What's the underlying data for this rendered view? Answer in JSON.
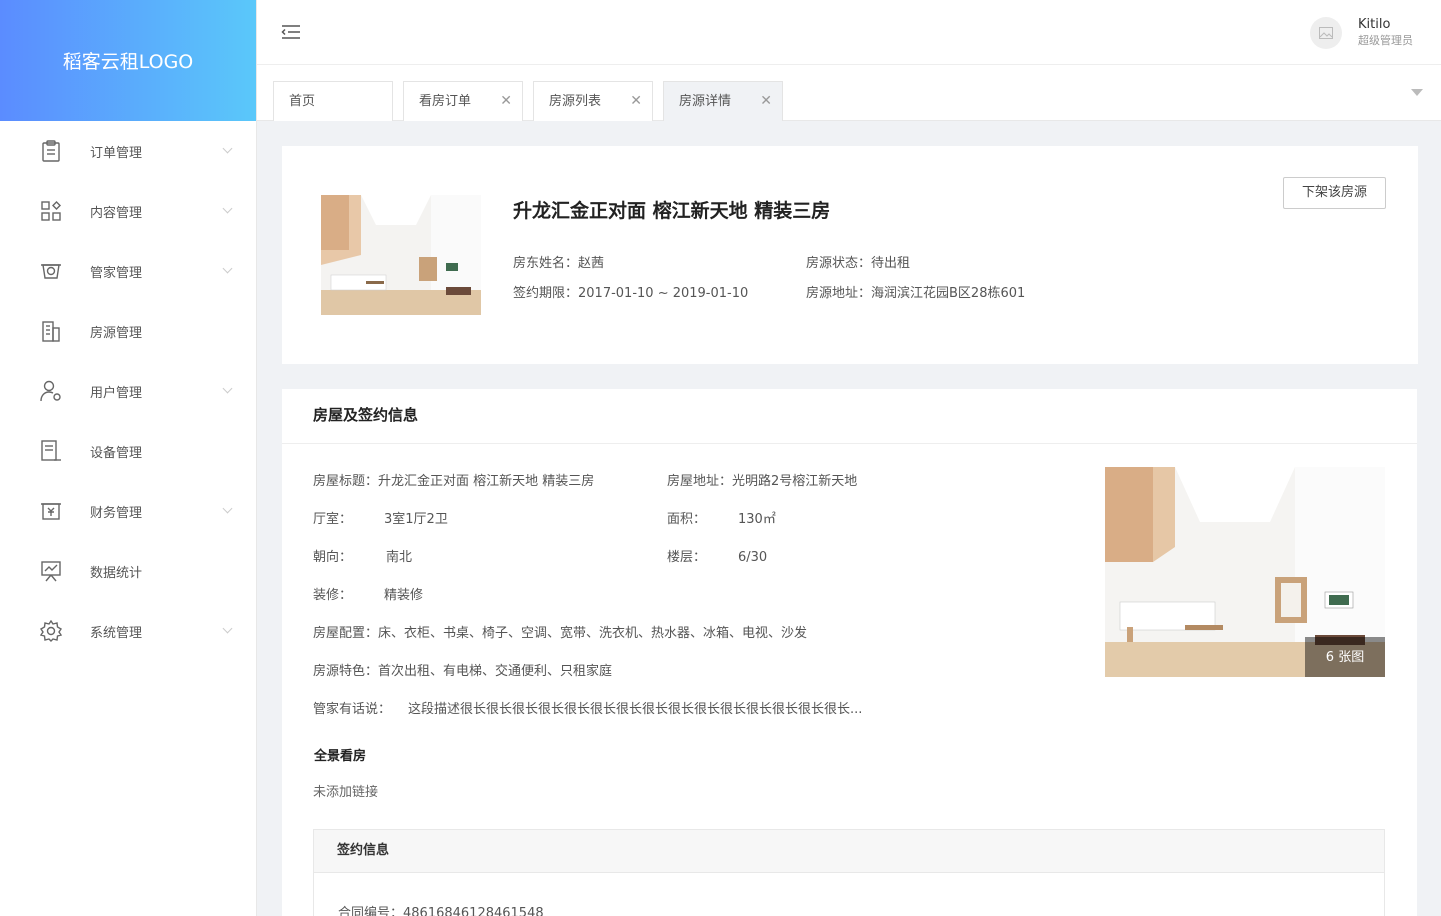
{
  "logo": "稻客云租LOGO",
  "sidebar": {
    "items": [
      {
        "label": "订单管理",
        "icon": "clipboard-icon",
        "has_arrow": true
      },
      {
        "label": "内容管理",
        "icon": "grid-icon",
        "has_arrow": true
      },
      {
        "label": "管家管理",
        "icon": "badge-icon",
        "has_arrow": true
      },
      {
        "label": "房源管理",
        "icon": "building-icon",
        "has_arrow": false
      },
      {
        "label": "用户管理",
        "icon": "user-gear-icon",
        "has_arrow": true
      },
      {
        "label": "设备管理",
        "icon": "device-icon",
        "has_arrow": false
      },
      {
        "label": "财务管理",
        "icon": "finance-icon",
        "has_arrow": true
      },
      {
        "label": "数据统计",
        "icon": "chart-board-icon",
        "has_arrow": false
      },
      {
        "label": "系统管理",
        "icon": "settings-icon",
        "has_arrow": true
      }
    ]
  },
  "header": {
    "user_name": "Kitilo",
    "user_role": "超级管理员"
  },
  "tabs": [
    {
      "label": "首页",
      "closable": false
    },
    {
      "label": "看房订单",
      "closable": true
    },
    {
      "label": "房源列表",
      "closable": true
    },
    {
      "label": "房源详情",
      "closable": true
    }
  ],
  "summary": {
    "title": "升龙汇金正对面 榕江新天地 精装三房",
    "offline_button": "下架该房源",
    "landlord_label": "房东姓名：",
    "landlord": "赵茜",
    "status_label": "房源状态：",
    "status": "待出租",
    "term_label": "签约期限：",
    "term": "2017-01-10 ~ 2019-01-10",
    "address_label": "房源地址：",
    "address": "海润滨江花园B区28栋601"
  },
  "details": {
    "section_title": "房屋及签约信息",
    "house_title_label": "房屋标题：",
    "house_title": "升龙汇金正对面 榕江新天地 精装三房",
    "house_address_label": "房屋地址：",
    "house_address": "光明路2号榕江新天地",
    "rooms_label": "厅室：",
    "rooms": "3室1厅2卫",
    "area_label": "面积：",
    "area": "130㎡",
    "orientation_label": "朝向：",
    "orientation": "南北",
    "floor_label": "楼层：",
    "floor": "6/30",
    "decoration_label": "装修：",
    "decoration": "精装修",
    "facilities_label": "房屋配置：",
    "facilities": "床、衣柜、书桌、椅子、空调、宽带、洗衣机、热水器、冰箱、电视、沙发",
    "features_label": "房源特色：",
    "features": "首次出租、有电梯、交通便利、只租家庭",
    "butler_label": "管家有话说：",
    "butler": "这段描述很长很长很长很长很长很长很长很长很长很长很长很长很长很长很长...",
    "photo_count": "6 张图",
    "panorama_title": "全景看房",
    "panorama_value": "未添加链接",
    "contract_title": "签约信息",
    "contract_no_label": "合同编号：",
    "contract_no": "48616846128461548"
  }
}
